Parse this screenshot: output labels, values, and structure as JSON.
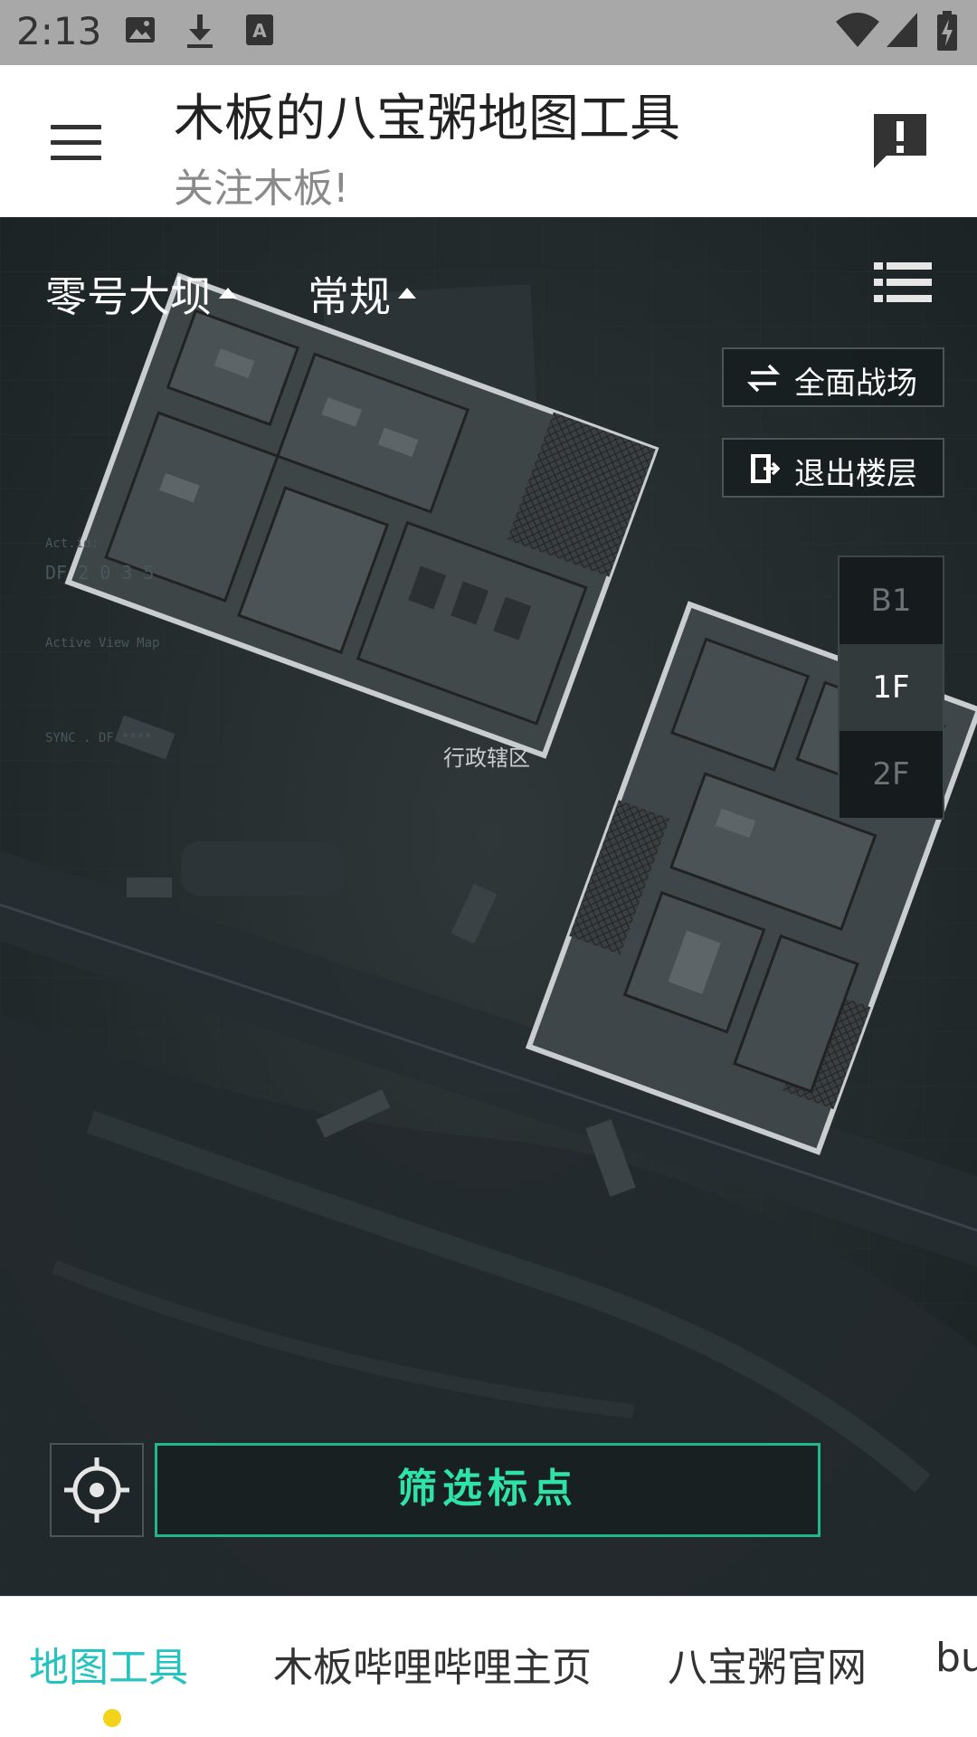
{
  "status_bar": {
    "time": "2:13"
  },
  "app_bar": {
    "title": "木板的八宝粥地图工具",
    "subtitle": "关注木板!"
  },
  "map": {
    "map_selector": "零号大坝",
    "mode_selector": "常规",
    "full_battlefield_label": "全面战场",
    "exit_floor_label": "退出楼层",
    "floors": [
      "B1",
      "1F",
      "2F"
    ],
    "active_floor": "1F",
    "region_label": "行政辖区",
    "filter_button_label": "筛选标点",
    "overlay_text": {
      "act_id": "Act.id:",
      "df_code": "DF  2 0 3 5",
      "active_map": "Active View Map",
      "sync": "SYNC . DF ****"
    }
  },
  "tabs": [
    {
      "label": "地图工具",
      "active": true
    },
    {
      "label": "木板哔哩哔哩主页",
      "active": false
    },
    {
      "label": "八宝粥官网",
      "active": false
    },
    {
      "label": "bu",
      "active": false
    }
  ],
  "colors": {
    "accent_green": "#2fe3a6",
    "tab_active": "#23c4c0",
    "tab_indicator": "#f2d31b",
    "status_bar_bg": "#a8a8a8"
  },
  "icons": {
    "menu": "hamburger-icon",
    "feedback": "feedback-alert-icon",
    "list": "list-icon",
    "swap": "swap-icon",
    "exit": "exit-door-icon",
    "locate": "crosshair-locate-icon"
  }
}
